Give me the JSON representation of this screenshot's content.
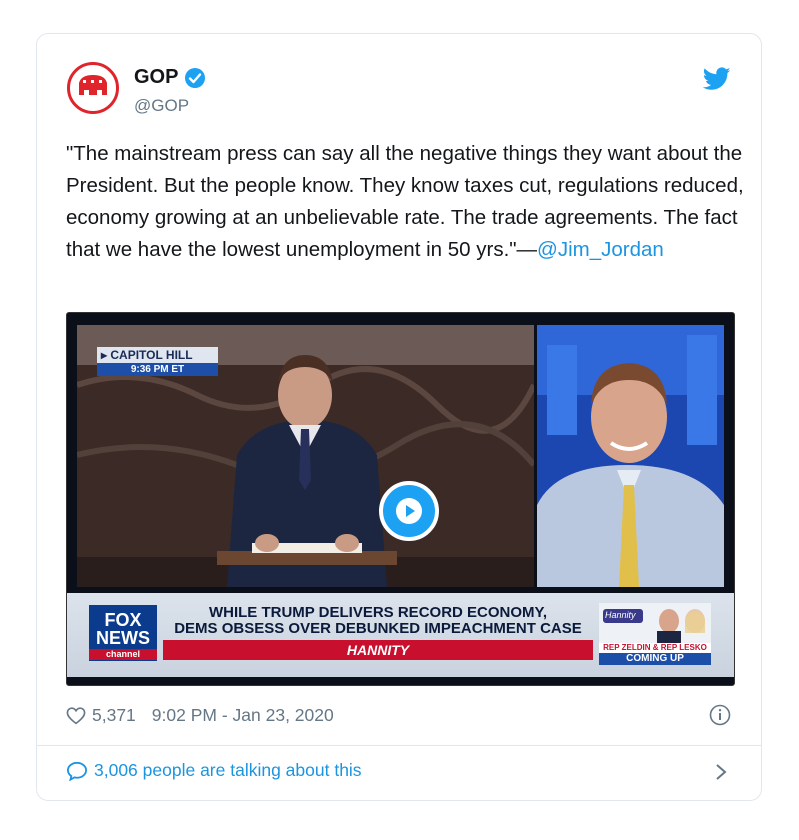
{
  "tweet": {
    "display_name": "GOP",
    "handle": "@GOP",
    "text": "\"The mainstream press can say all the negative things they want about the President. But the people know. They know taxes cut, regulations reduced, economy growing at an unbelievable rate. The trade agreements. The fact that we have the lowest unemployment in 50 yrs.\"—",
    "mention": "@Jim_Jordan",
    "like_count": "5,371",
    "timestamp": "9:02 PM - Jan 23, 2020",
    "talking_text": "3,006 people are talking about this"
  },
  "video": {
    "location_tag": "CAPITOL HILL",
    "time_tag": "9:36 PM ET",
    "headline_line1": "WHILE TRUMP DELIVERS RECORD ECONOMY,",
    "headline_line2": "DEMS OBSESS OVER DEBUNKED IMPEACHMENT CASE",
    "show_name": "HANNITY",
    "network_line1": "FOX",
    "network_line2": "NEWS",
    "network_line3": "channel",
    "promo_show": "Hannity",
    "promo_guests": "REP ZELDIN & REP LESKO",
    "promo_status": "COMING UP"
  },
  "colors": {
    "accent": "#1b95e0",
    "gop_red": "#e0242b",
    "secondary_text": "#657786"
  },
  "icons": [
    "gop-elephant-logo",
    "verified-badge-icon",
    "twitter-bird-icon",
    "play-icon",
    "heart-icon",
    "info-icon",
    "speech-bubble-icon",
    "chevron-right-icon"
  ]
}
